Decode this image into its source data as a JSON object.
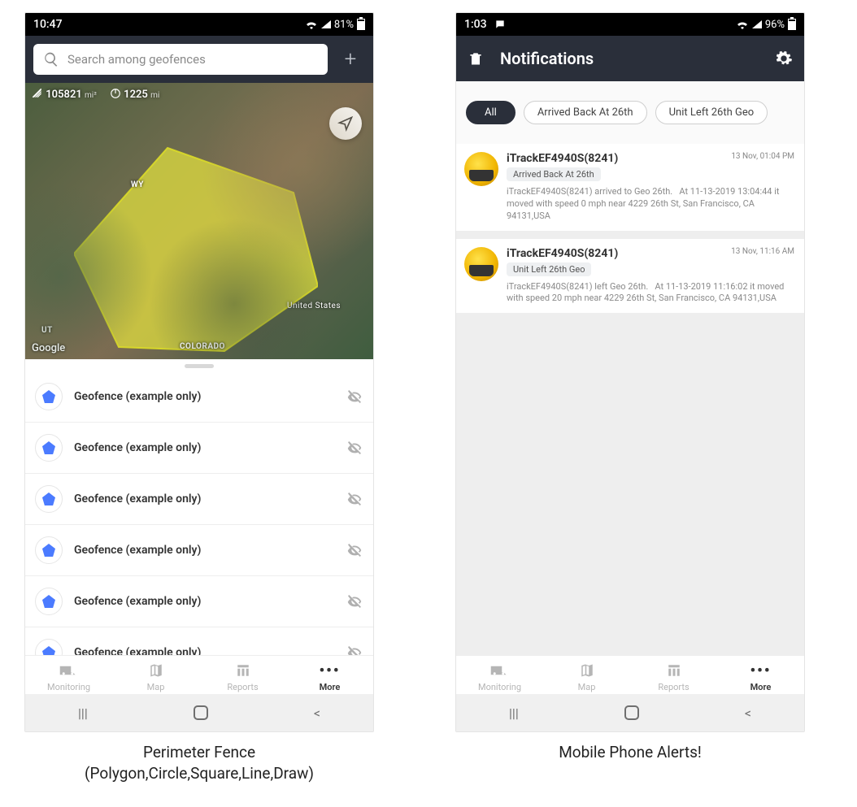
{
  "left": {
    "status": {
      "time": "10:47",
      "battery": "81%"
    },
    "search": {
      "placeholder": "Search among geofences"
    },
    "metrics": {
      "area_value": "105821",
      "area_unit": "mi²",
      "perimeter_value": "1225",
      "perimeter_unit": "mi"
    },
    "map_labels": {
      "wy": "WY",
      "ut": "UT",
      "co": "COLORADO",
      "us": "United States",
      "google": "Google"
    },
    "rows": [
      {
        "label": "Geofence (example only)"
      },
      {
        "label": "Geofence (example only)"
      },
      {
        "label": "Geofence (example only)"
      },
      {
        "label": "Geofence (example only)"
      },
      {
        "label": "Geofence (example only)"
      },
      {
        "label": "Geofence (example only)"
      }
    ],
    "bottom": {
      "monitoring": "Monitoring",
      "map": "Map",
      "reports": "Reports",
      "more": "More"
    },
    "caption_line1": "Perimeter Fence",
    "caption_line2": "(Polygon,Circle,Square,Line,Draw)"
  },
  "right": {
    "status": {
      "time": "1:03",
      "battery": "96%"
    },
    "title": "Notifications",
    "filters": {
      "all": "All",
      "f1": "Arrived Back At 26th",
      "f2": "Unit Left 26th Geo"
    },
    "items": [
      {
        "title": "iTrackEF4940S(8241)",
        "time": "13 Nov, 01:04 PM",
        "tag": "Arrived Back At 26th",
        "text": "iTrackEF4940S(8241) arrived to Geo 26th.   At 11-13-2019 13:04:44 it moved with speed 0 mph near 4229 26th St, San Francisco, CA 94131,USA"
      },
      {
        "title": "iTrackEF4940S(8241)",
        "time": "13 Nov, 11:16 AM",
        "tag": "Unit Left 26th Geo",
        "text": "iTrackEF4940S(8241) left Geo 26th.   At 11-13-2019 11:16:02 it moved with speed 20 mph near 4229 26th St, San Francisco, CA 94131,USA"
      }
    ],
    "bottom": {
      "monitoring": "Monitoring",
      "map": "Map",
      "reports": "Reports",
      "more": "More"
    },
    "caption": "Mobile Phone Alerts!"
  }
}
